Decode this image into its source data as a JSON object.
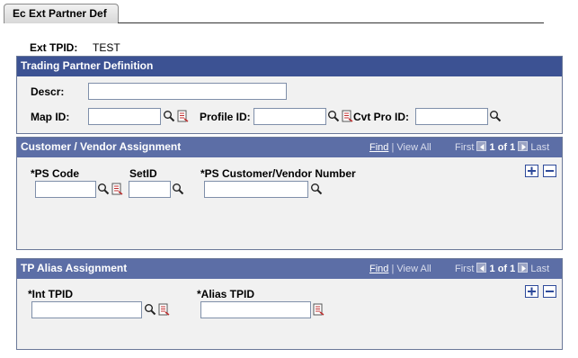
{
  "tab": {
    "label": "Ec Ext Partner Def"
  },
  "header": {
    "ext_tpid_label": "Ext TPID:",
    "ext_tpid_value": "TEST"
  },
  "trading_partner": {
    "title": "Trading Partner Definition",
    "descr_label": "Descr:",
    "descr_value": "",
    "map_id_label": "Map ID:",
    "map_id_value": "",
    "profile_id_label": "Profile ID:",
    "profile_id_value": "",
    "cvt_pro_id_label": "Cvt Pro ID:",
    "cvt_pro_id_value": ""
  },
  "customer_vendor": {
    "title": "Customer / Vendor Assignment",
    "nav": {
      "find": "Find",
      "sep": "|",
      "view_all": "View All",
      "first": "First",
      "count": "1 of 1",
      "last": "Last"
    },
    "ps_code_label": "*PS Code",
    "ps_code_value": "",
    "setid_label": "SetID",
    "setid_value": "",
    "ps_number_label": "*PS Customer/Vendor Number",
    "ps_number_value": ""
  },
  "tp_alias": {
    "title": "TP Alias Assignment",
    "nav": {
      "find": "Find",
      "sep": "|",
      "view_all": "View All",
      "first": "First",
      "count": "1 of 1",
      "last": "Last"
    },
    "int_tpid_label": "*Int TPID",
    "int_tpid_value": "",
    "alias_tpid_label": "*Alias TPID",
    "alias_tpid_value": ""
  },
  "icons": {
    "lookup": "magnifier-icon",
    "detail": "detail-page-icon",
    "add_row": "plus-icon",
    "delete_row": "minus-icon",
    "first": "arrow-left-icon",
    "last": "arrow-right-icon"
  },
  "colors": {
    "header_bar": "#3c5293",
    "grid_header": "#5c6ea6",
    "panel_bg": "#f1f1f1"
  }
}
